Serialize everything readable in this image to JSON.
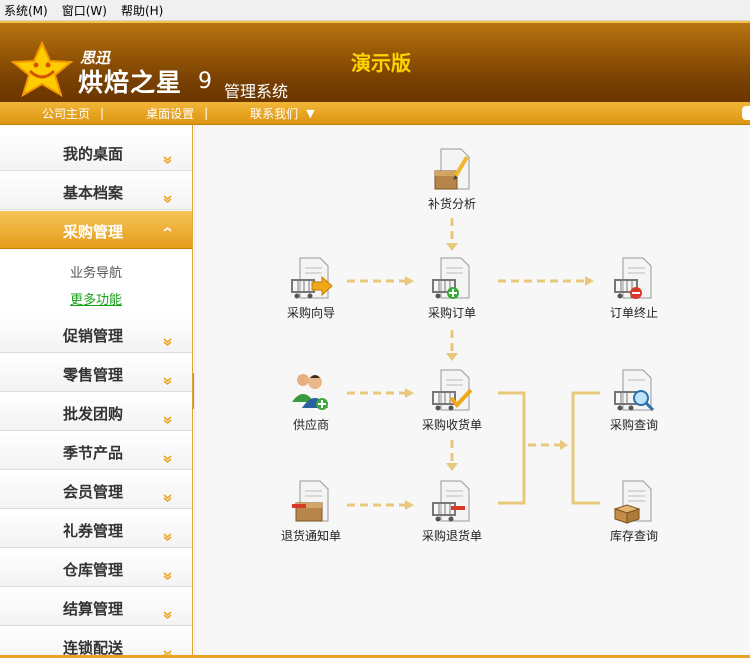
{
  "menubar": {
    "items": [
      "系统(M)",
      "窗口(W)",
      "帮助(H)"
    ]
  },
  "header": {
    "brand_small": "思迅",
    "brand_big": "烘焙之星",
    "brand_version": "9",
    "brand_suffix": "管理系统",
    "edition": "演示版"
  },
  "linkbar": {
    "home": "公司主页",
    "desktop_settings": "桌面设置",
    "contact": "联系我们",
    "separator": "|"
  },
  "sidebar": {
    "items": [
      {
        "label": "我的桌面"
      },
      {
        "label": "基本档案"
      },
      {
        "label": "采购管理"
      },
      {
        "label": "促销管理"
      },
      {
        "label": "零售管理"
      },
      {
        "label": "批发团购"
      },
      {
        "label": "季节产品"
      },
      {
        "label": "会员管理"
      },
      {
        "label": "礼券管理"
      },
      {
        "label": "仓库管理"
      },
      {
        "label": "结算管理"
      },
      {
        "label": "连锁配送"
      }
    ],
    "active_index": 2,
    "sub_nav": "业务导航",
    "sub_more": "更多功能"
  },
  "flow": {
    "restock_analysis": "补货分析",
    "purchase_wizard": "采购向导",
    "purchase_order": "采购订单",
    "order_terminate": "订单终止",
    "supplier": "供应商",
    "purchase_receipt": "采购收货单",
    "purchase_query": "采购查询",
    "return_notice": "退货通知单",
    "purchase_return": "采购退货单",
    "stock_query": "库存查询"
  },
  "colors": {
    "header_brown": "#7a4102",
    "accent_orange": "#f0a92a",
    "edition_yellow": "#ffd400",
    "arrow_tan": "#e8c87a",
    "link_green": "#18a018"
  }
}
